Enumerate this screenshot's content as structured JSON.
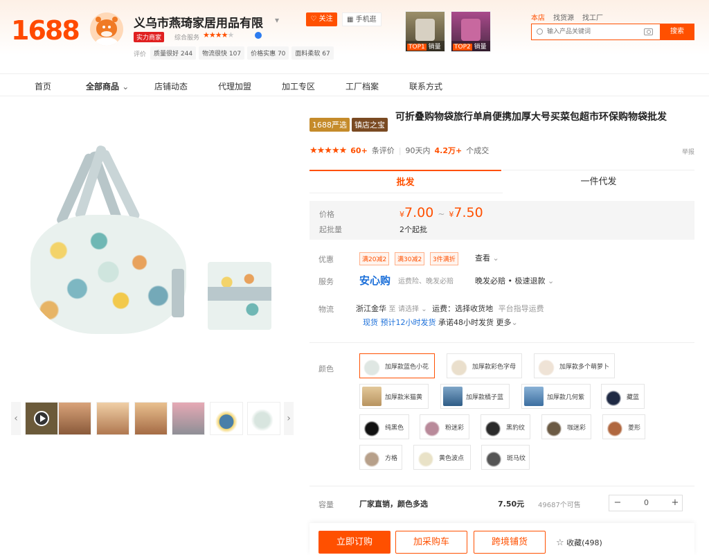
{
  "header": {
    "logo": "1688",
    "shop_name": "义乌市燕琦家居用品有限",
    "follow": "关注",
    "mobile": "手机逛",
    "merchant_badge": "实力商家",
    "score_label": "综合服务",
    "eval_label": "评价",
    "metrics": [
      "质量很好 244",
      "物流很快 107",
      "价格实惠 70",
      "面料柔软 67"
    ],
    "top_products": [
      {
        "rank": "TOP1",
        "label": "销量"
      },
      {
        "rank": "TOP2",
        "label": "销量"
      }
    ],
    "search_tabs": [
      "本店",
      "找货源",
      "找工厂"
    ],
    "search_placeholder": "输入产品关键词",
    "search_button": "搜索"
  },
  "nav": [
    "首页",
    "全部商品",
    "店铺动态",
    "代理加盟",
    "加工专区",
    "工厂档案",
    "联系方式"
  ],
  "product": {
    "tag_select": "1688严选",
    "tag_treasure": "镇店之宝",
    "title": "可折叠购物袋旅行单肩便携加厚大号买菜包超市环保购物袋批发",
    "rating_count": "60+",
    "rating_text": "条评价",
    "sales_prefix": "90天内",
    "sales_count": "4.2万+",
    "sales_suffix": "个成交",
    "report": "举报"
  },
  "tabs": {
    "wholesale": "批发",
    "dropship": "一件代发"
  },
  "price": {
    "label": "价格",
    "currency": "¥",
    "low": "7.00",
    "high": "7.50",
    "moq_label": "起批量",
    "moq": "2个起批"
  },
  "promo": {
    "label": "优惠",
    "coupons": [
      "满20减2",
      "满30减2",
      "3件满折"
    ],
    "view": "查看"
  },
  "service": {
    "label": "服务",
    "brand": "安心购",
    "desc": "运费险、晚发必赔",
    "extra": "晚发必赔 • 极速退款"
  },
  "logistics": {
    "label": "物流",
    "origin": "浙江金华",
    "to": "至",
    "select": "请选择",
    "fee": "运费：选择收货地",
    "platform": "平台指导运费",
    "stock": "现货",
    "ship": "预计12小时发货",
    "promise": "承诺48小时发货",
    "more": "更多"
  },
  "color": {
    "label": "颜色",
    "options": [
      "加厚款蓝色小花",
      "加厚款彩色字母",
      "加厚款多个萌萝卜",
      "加厚款米猫黄",
      "加厚款橘子蓝",
      "加厚款几何紫",
      "藏蓝",
      "纯黑色",
      "粉迷彩",
      "黑豹纹",
      "咖迷彩",
      "菱形",
      "方格",
      "黄色波点",
      "斑马纹"
    ]
  },
  "capacity": {
    "label": "容量",
    "desc": "厂家直销，颜色多选",
    "price": "7.50元",
    "stock": "49687个可售",
    "minus": "−",
    "qty": "0",
    "plus": "+"
  },
  "actions": {
    "buy": "立即订购",
    "cart": "加采购车",
    "cross": "跨境铺货",
    "fav": "收藏(498)"
  }
}
